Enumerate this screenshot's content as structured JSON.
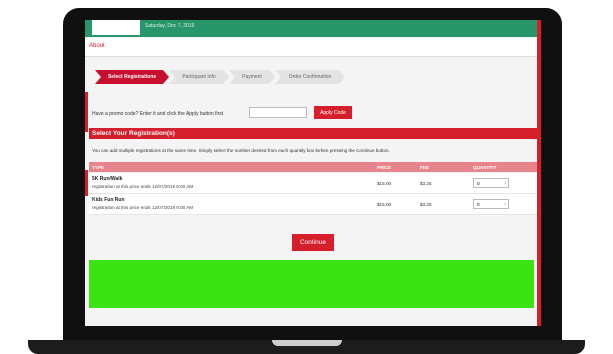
{
  "header": {
    "date_text": "Saturday, Dec 7, 2019"
  },
  "nav": {
    "about_label": "About"
  },
  "steps": [
    {
      "label": "Select Registrations",
      "active": true
    },
    {
      "label": "Participant Info",
      "active": false
    },
    {
      "label": "Payment",
      "active": false
    },
    {
      "label": "Order Confirmation",
      "active": false
    }
  ],
  "promo": {
    "label": "Have a promo code? Enter it and click the Apply button first",
    "input_value": "",
    "button_label": "Apply Code"
  },
  "registrations": {
    "title": "Select Your Registration(s)",
    "info": "You can add multiple registrations at the same time. Simply select the number desired from each quantity box before pressing the Continue button.",
    "columns": [
      "TYPE",
      "PRICE",
      "FEE",
      "QUANTITY"
    ],
    "rows": [
      {
        "name": "5K Run/Walk",
        "note": "registration at this price ends 12/07/2019 9:00 AM",
        "price": "$15.00",
        "fee": "$3.25",
        "quantity": "0"
      },
      {
        "name": "Kids Fun Run",
        "note": "registration at this price ends 12/07/2019 9:00 AM",
        "price": "$15.00",
        "fee": "$3.25",
        "quantity": "0"
      }
    ]
  },
  "actions": {
    "continue_label": "Continue"
  },
  "colors": {
    "brand_red": "#d61f2c",
    "header_green": "#27966a",
    "table_header": "#e8848b",
    "highlight_green": "#3ce313"
  }
}
